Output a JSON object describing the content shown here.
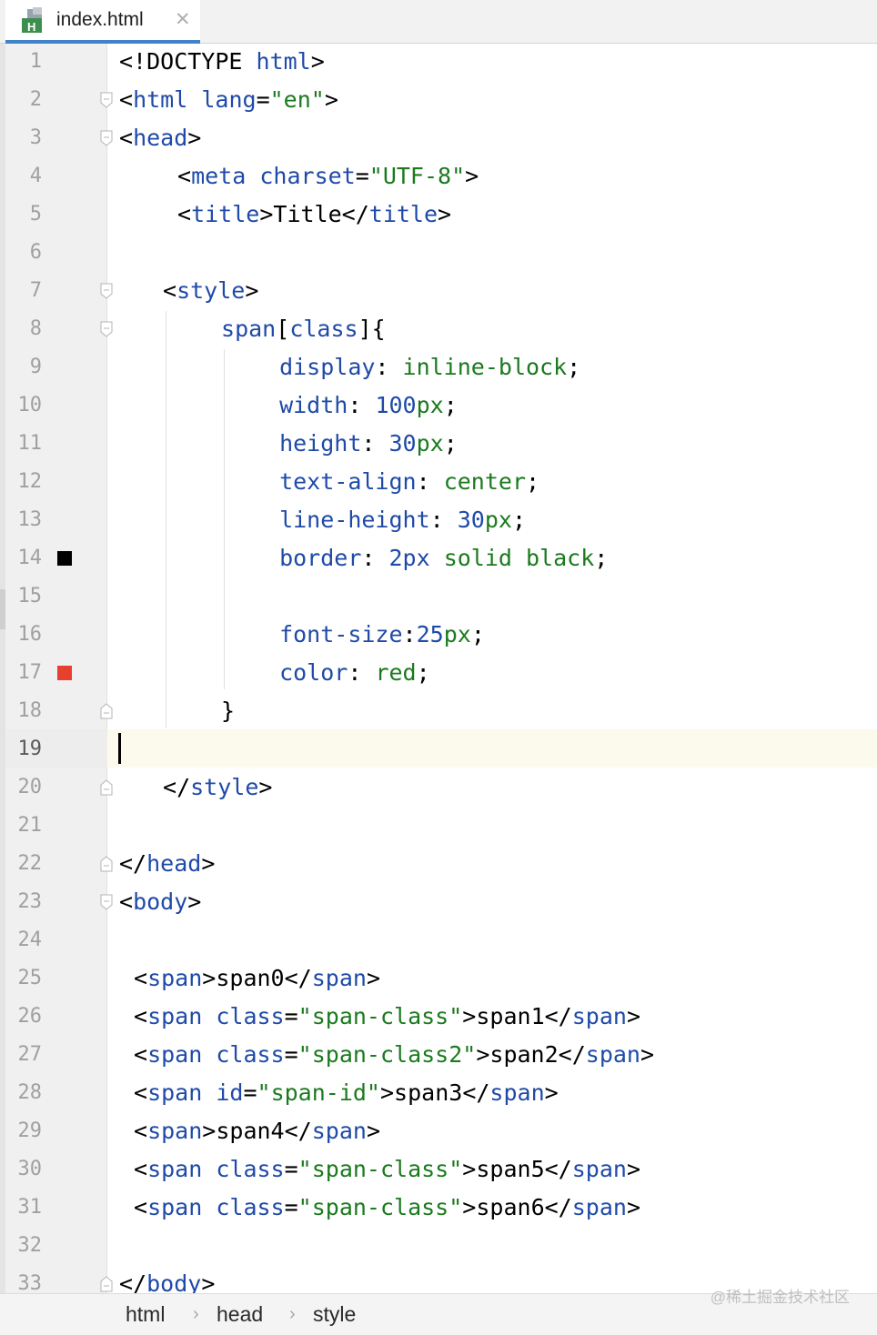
{
  "tab": {
    "label": "index.html",
    "close": "✕",
    "icon_letter": "H"
  },
  "colors": {
    "tag_name": "#1f4aa8",
    "attribute": "#1f4aa8",
    "string": "#1b7a1e",
    "property": "#1f4aa8",
    "value": "#1b7a1e",
    "swatch_black": "#000000",
    "swatch_red": "#e8402f",
    "tab_underline": "#4083c9"
  },
  "editor": {
    "current_line": 19,
    "lines": [
      {
        "n": "1",
        "indent": 0,
        "tokens": [
          {
            "t": "<!DOCTYPE ",
            "c": "doctype"
          },
          {
            "t": "html",
            "c": "tagname"
          },
          {
            "t": ">",
            "c": "tag"
          }
        ]
      },
      {
        "n": "2",
        "indent": 0,
        "tokens": [
          {
            "t": "<",
            "c": "tag"
          },
          {
            "t": "html",
            "c": "tagname"
          },
          {
            "t": " ",
            "c": "text"
          },
          {
            "t": "lang",
            "c": "attr"
          },
          {
            "t": "=",
            "c": "tag"
          },
          {
            "t": "\"en\"",
            "c": "str"
          },
          {
            "t": ">",
            "c": "tag"
          }
        ]
      },
      {
        "n": "3",
        "indent": 0,
        "tokens": [
          {
            "t": "<",
            "c": "tag"
          },
          {
            "t": "head",
            "c": "tagname"
          },
          {
            "t": ">",
            "c": "tag"
          }
        ]
      },
      {
        "n": "4",
        "indent": 4,
        "tokens": [
          {
            "t": "<",
            "c": "tag"
          },
          {
            "t": "meta",
            "c": "tagname"
          },
          {
            "t": " ",
            "c": "text"
          },
          {
            "t": "charset",
            "c": "attr"
          },
          {
            "t": "=",
            "c": "tag"
          },
          {
            "t": "\"UTF-8\"",
            "c": "str"
          },
          {
            "t": ">",
            "c": "tag"
          }
        ]
      },
      {
        "n": "5",
        "indent": 4,
        "tokens": [
          {
            "t": "<",
            "c": "tag"
          },
          {
            "t": "title",
            "c": "tagname"
          },
          {
            "t": ">",
            "c": "tag"
          },
          {
            "t": "Title",
            "c": "text"
          },
          {
            "t": "</",
            "c": "tag"
          },
          {
            "t": "title",
            "c": "tagname"
          },
          {
            "t": ">",
            "c": "tag"
          }
        ]
      },
      {
        "n": "6",
        "indent": 0,
        "tokens": []
      },
      {
        "n": "7",
        "indent": 3,
        "tokens": [
          {
            "t": "<",
            "c": "tag"
          },
          {
            "t": "style",
            "c": "tagname"
          },
          {
            "t": ">",
            "c": "tag"
          }
        ]
      },
      {
        "n": "8",
        "indent": 7,
        "tokens": [
          {
            "t": "span",
            "c": "tagname"
          },
          {
            "t": "[",
            "c": "tag"
          },
          {
            "t": "class",
            "c": "attr"
          },
          {
            "t": "]{",
            "c": "tag"
          }
        ]
      },
      {
        "n": "9",
        "indent": 11,
        "tokens": [
          {
            "t": "display",
            "c": "prop"
          },
          {
            "t": ": ",
            "c": "tag"
          },
          {
            "t": "inline-block",
            "c": "val"
          },
          {
            "t": ";",
            "c": "tag"
          }
        ]
      },
      {
        "n": "10",
        "indent": 11,
        "tokens": [
          {
            "t": "width",
            "c": "prop"
          },
          {
            "t": ": ",
            "c": "tag"
          },
          {
            "t": "100",
            "c": "num"
          },
          {
            "t": "px",
            "c": "val"
          },
          {
            "t": ";",
            "c": "tag"
          }
        ]
      },
      {
        "n": "11",
        "indent": 11,
        "tokens": [
          {
            "t": "height",
            "c": "prop"
          },
          {
            "t": ": ",
            "c": "tag"
          },
          {
            "t": "30",
            "c": "num"
          },
          {
            "t": "px",
            "c": "val"
          },
          {
            "t": ";",
            "c": "tag"
          }
        ]
      },
      {
        "n": "12",
        "indent": 11,
        "tokens": [
          {
            "t": "text-align",
            "c": "prop"
          },
          {
            "t": ": ",
            "c": "tag"
          },
          {
            "t": "center",
            "c": "val"
          },
          {
            "t": ";",
            "c": "tag"
          }
        ]
      },
      {
        "n": "13",
        "indent": 11,
        "tokens": [
          {
            "t": "line-height",
            "c": "prop"
          },
          {
            "t": ": ",
            "c": "tag"
          },
          {
            "t": "30",
            "c": "num"
          },
          {
            "t": "px",
            "c": "val"
          },
          {
            "t": ";",
            "c": "tag"
          }
        ]
      },
      {
        "n": "14",
        "indent": 11,
        "swatch": "black",
        "tokens": [
          {
            "t": "border",
            "c": "prop"
          },
          {
            "t": ": ",
            "c": "tag"
          },
          {
            "t": "2px",
            "c": "num"
          },
          {
            "t": " solid black",
            "c": "val"
          },
          {
            "t": ";",
            "c": "tag"
          }
        ]
      },
      {
        "n": "15",
        "indent": 0,
        "tokens": []
      },
      {
        "n": "16",
        "indent": 11,
        "tokens": [
          {
            "t": "font-size",
            "c": "prop"
          },
          {
            "t": ":",
            "c": "tag"
          },
          {
            "t": "25",
            "c": "num"
          },
          {
            "t": "px",
            "c": "val"
          },
          {
            "t": ";",
            "c": "tag"
          }
        ]
      },
      {
        "n": "17",
        "indent": 11,
        "swatch": "red",
        "tokens": [
          {
            "t": "color",
            "c": "prop"
          },
          {
            "t": ": ",
            "c": "tag"
          },
          {
            "t": "red",
            "c": "val"
          },
          {
            "t": ";",
            "c": "tag"
          }
        ]
      },
      {
        "n": "18",
        "indent": 7,
        "tokens": [
          {
            "t": "}",
            "c": "tag"
          }
        ]
      },
      {
        "n": "19",
        "indent": 0,
        "tokens": []
      },
      {
        "n": "20",
        "indent": 3,
        "tokens": [
          {
            "t": "</",
            "c": "tag"
          },
          {
            "t": "style",
            "c": "tagname"
          },
          {
            "t": ">",
            "c": "tag"
          }
        ]
      },
      {
        "n": "21",
        "indent": 0,
        "tokens": []
      },
      {
        "n": "22",
        "indent": 0,
        "tokens": [
          {
            "t": "</",
            "c": "tag"
          },
          {
            "t": "head",
            "c": "tagname"
          },
          {
            "t": ">",
            "c": "tag"
          }
        ]
      },
      {
        "n": "23",
        "indent": 0,
        "tokens": [
          {
            "t": "<",
            "c": "tag"
          },
          {
            "t": "body",
            "c": "tagname"
          },
          {
            "t": ">",
            "c": "tag"
          }
        ]
      },
      {
        "n": "24",
        "indent": 0,
        "tokens": []
      },
      {
        "n": "25",
        "indent": 1,
        "tokens": [
          {
            "t": "<",
            "c": "tag"
          },
          {
            "t": "span",
            "c": "tagname"
          },
          {
            "t": ">",
            "c": "tag"
          },
          {
            "t": "span0",
            "c": "text"
          },
          {
            "t": "</",
            "c": "tag"
          },
          {
            "t": "span",
            "c": "tagname"
          },
          {
            "t": ">",
            "c": "tag"
          }
        ]
      },
      {
        "n": "26",
        "indent": 1,
        "tokens": [
          {
            "t": "<",
            "c": "tag"
          },
          {
            "t": "span",
            "c": "tagname"
          },
          {
            "t": " ",
            "c": "text"
          },
          {
            "t": "class",
            "c": "attr"
          },
          {
            "t": "=",
            "c": "tag"
          },
          {
            "t": "\"span-class\"",
            "c": "str"
          },
          {
            "t": ">",
            "c": "tag"
          },
          {
            "t": "span1",
            "c": "text"
          },
          {
            "t": "</",
            "c": "tag"
          },
          {
            "t": "span",
            "c": "tagname"
          },
          {
            "t": ">",
            "c": "tag"
          }
        ]
      },
      {
        "n": "27",
        "indent": 1,
        "tokens": [
          {
            "t": "<",
            "c": "tag"
          },
          {
            "t": "span",
            "c": "tagname"
          },
          {
            "t": " ",
            "c": "text"
          },
          {
            "t": "class",
            "c": "attr"
          },
          {
            "t": "=",
            "c": "tag"
          },
          {
            "t": "\"span-class2\"",
            "c": "str"
          },
          {
            "t": ">",
            "c": "tag"
          },
          {
            "t": "span2",
            "c": "text"
          },
          {
            "t": "</",
            "c": "tag"
          },
          {
            "t": "span",
            "c": "tagname"
          },
          {
            "t": ">",
            "c": "tag"
          }
        ]
      },
      {
        "n": "28",
        "indent": 1,
        "tokens": [
          {
            "t": "<",
            "c": "tag"
          },
          {
            "t": "span",
            "c": "tagname"
          },
          {
            "t": " ",
            "c": "text"
          },
          {
            "t": "id",
            "c": "attr"
          },
          {
            "t": "=",
            "c": "tag"
          },
          {
            "t": "\"span-id\"",
            "c": "str"
          },
          {
            "t": ">",
            "c": "tag"
          },
          {
            "t": "span3",
            "c": "text"
          },
          {
            "t": "</",
            "c": "tag"
          },
          {
            "t": "span",
            "c": "tagname"
          },
          {
            "t": ">",
            "c": "tag"
          }
        ]
      },
      {
        "n": "29",
        "indent": 1,
        "tokens": [
          {
            "t": "<",
            "c": "tag"
          },
          {
            "t": "span",
            "c": "tagname"
          },
          {
            "t": ">",
            "c": "tag"
          },
          {
            "t": "span4",
            "c": "text"
          },
          {
            "t": "</",
            "c": "tag"
          },
          {
            "t": "span",
            "c": "tagname"
          },
          {
            "t": ">",
            "c": "tag"
          }
        ]
      },
      {
        "n": "30",
        "indent": 1,
        "tokens": [
          {
            "t": "<",
            "c": "tag"
          },
          {
            "t": "span",
            "c": "tagname"
          },
          {
            "t": " ",
            "c": "text"
          },
          {
            "t": "class",
            "c": "attr"
          },
          {
            "t": "=",
            "c": "tag"
          },
          {
            "t": "\"span-class\"",
            "c": "str"
          },
          {
            "t": ">",
            "c": "tag"
          },
          {
            "t": "span5",
            "c": "text"
          },
          {
            "t": "</",
            "c": "tag"
          },
          {
            "t": "span",
            "c": "tagname"
          },
          {
            "t": ">",
            "c": "tag"
          }
        ]
      },
      {
        "n": "31",
        "indent": 1,
        "tokens": [
          {
            "t": "<",
            "c": "tag"
          },
          {
            "t": "span",
            "c": "tagname"
          },
          {
            "t": " ",
            "c": "text"
          },
          {
            "t": "class",
            "c": "attr"
          },
          {
            "t": "=",
            "c": "tag"
          },
          {
            "t": "\"span-class\"",
            "c": "str"
          },
          {
            "t": ">",
            "c": "tag"
          },
          {
            "t": "span6",
            "c": "text"
          },
          {
            "t": "</",
            "c": "tag"
          },
          {
            "t": "span",
            "c": "tagname"
          },
          {
            "t": ">",
            "c": "tag"
          }
        ]
      },
      {
        "n": "32",
        "indent": 0,
        "tokens": []
      },
      {
        "n": "33",
        "indent": 0,
        "tokens": [
          {
            "t": "</",
            "c": "tag"
          },
          {
            "t": "body",
            "c": "tagname"
          },
          {
            "t": ">",
            "c": "tag"
          }
        ]
      }
    ]
  },
  "breadcrumbs": {
    "items": [
      "html",
      "head",
      "style"
    ],
    "separator": "›"
  },
  "watermark": "@稀土掘金技术社区"
}
